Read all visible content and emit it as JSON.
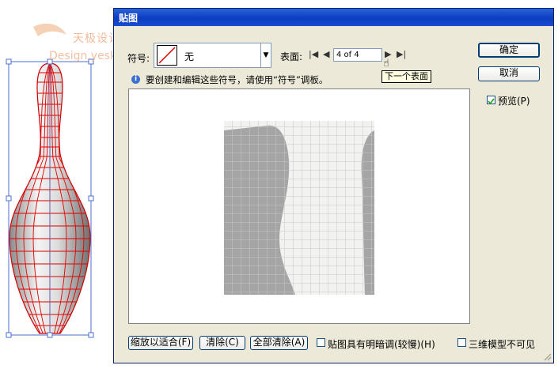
{
  "watermark": {
    "text": "天极设计在线",
    "url": "Design.yesky.com"
  },
  "dialog": {
    "title": "贴图",
    "symbol_label": "符号:",
    "symbol_value": "无",
    "surface_label": "表面:",
    "surface_value": "4 of 4",
    "info_text": "要创建和编辑这些符号，请使用“符号”调板。",
    "tooltip": "下一个表面",
    "ok_label": "确定",
    "cancel_label": "取消",
    "preview_label": "预览(P)",
    "preview_checked": true,
    "scale_fit_label": "缩放以适合(F)",
    "clear_label": "清除(C)",
    "clear_all_label": "全部清除(A)",
    "shade_label": "贴图具有明暗调(较慢)(H)",
    "shade_checked": false,
    "invisible_label": "三维模型不可见",
    "invisible_checked": false
  },
  "icons": [
    "first-surface-icon",
    "prev-surface-icon",
    "next-surface-icon",
    "last-surface-icon",
    "info-icon",
    "checkmark-icon",
    "dropdown-arrow-icon"
  ],
  "colors": {
    "titlebar": "#0a3dc2",
    "dialog_bg": "#ece9d8",
    "mesh": "#e00000",
    "map_dark": "#a5a5a5",
    "map_light": "#f2f2f0"
  }
}
